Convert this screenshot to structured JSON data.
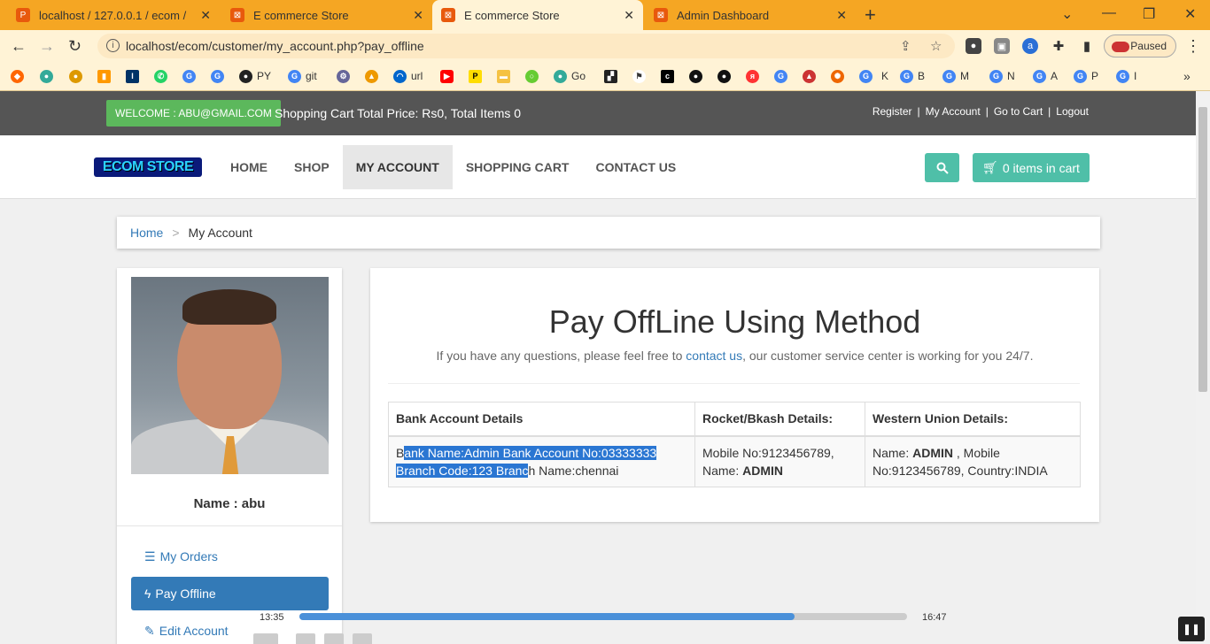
{
  "browser": {
    "tabs": [
      {
        "title": "localhost / 127.0.0.1 / ecom / cus",
        "active": false
      },
      {
        "title": "E commerce Store",
        "active": false
      },
      {
        "title": "E commerce Store",
        "active": true
      },
      {
        "title": "Admin Dashboard",
        "active": false
      }
    ],
    "url": "localhost/ecom/customer/my_account.php?pay_offline",
    "paused_label": "Paused",
    "bookmarks": [
      "PY",
      "git",
      "url",
      "Go",
      "K",
      "B",
      "M",
      "N",
      "A",
      "P",
      "I"
    ]
  },
  "topbar": {
    "welcome": "WELCOME : ABU@GMAIL.COM",
    "cart_total": "Shopping Cart Total Price: Rs0, Total Items 0",
    "links": [
      "Register",
      "My Account",
      "Go to Cart",
      "Logout"
    ],
    "separator": "|"
  },
  "nav": {
    "logo": "ECOM STORE",
    "menu": [
      "HOME",
      "SHOP",
      "MY ACCOUNT",
      "SHOPPING CART",
      "CONTACT US"
    ],
    "active": "MY ACCOUNT",
    "cart_button": "0 items in cart"
  },
  "breadcrumb": {
    "home": "Home",
    "sep": ">",
    "current": "My Account"
  },
  "sidebar": {
    "name": "Name : abu",
    "items": [
      {
        "label": "My Orders",
        "icon": "list-icon"
      },
      {
        "label": "Pay Offline",
        "icon": "bolt-icon"
      },
      {
        "label": "Edit Account",
        "icon": "pencil-icon"
      }
    ]
  },
  "main": {
    "title": "Pay OffLine Using Method",
    "sub_before": "If you have any questions, please feel free to ",
    "sub_link": "contact us",
    "sub_after": ", our customer service center is working for you 24/7.",
    "table": {
      "headers": [
        "Bank Account Details",
        "Rocket/Bkash Details:",
        "Western Union Details:"
      ],
      "bank_first": "B",
      "bank_selected_1": "ank Name:Admin Bank Account No:03333333",
      "bank_selected_2": "Branch Code:123 Branc",
      "bank_rest": "h Name:chennai",
      "rocket_1": "Mobile No:9123456789,",
      "rocket_2": "Name: ",
      "rocket_name": "ADMIN",
      "wu_1": "Name: ",
      "wu_name": "ADMIN",
      "wu_2": " , Mobile",
      "wu_3": "No:9123456789, Country:INDIA"
    }
  },
  "player": {
    "elapsed": "13:35",
    "total": "16:47",
    "progress": 0.815
  }
}
